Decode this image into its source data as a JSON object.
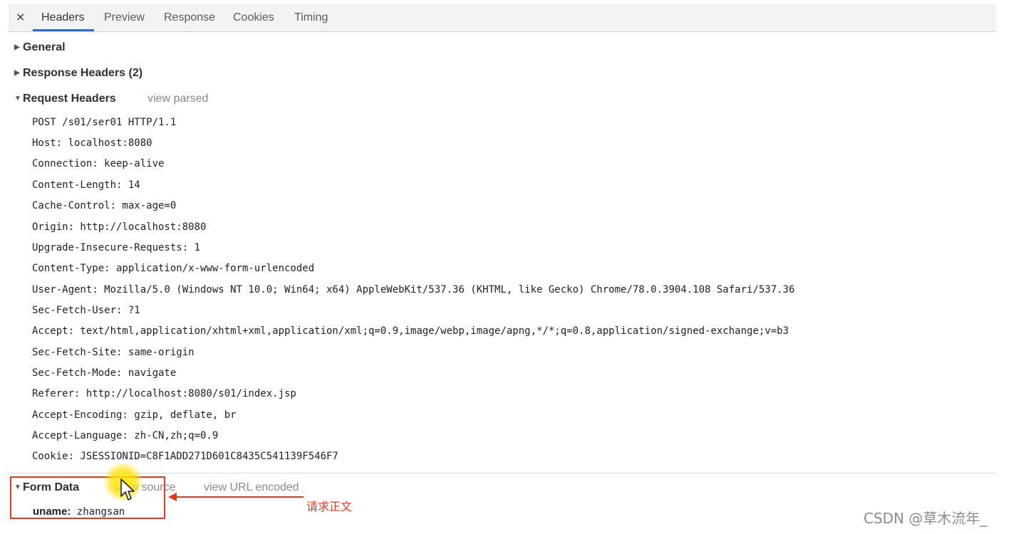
{
  "tabs": {
    "close": "×",
    "items": [
      "Headers",
      "Preview",
      "Response",
      "Cookies",
      "Timing"
    ],
    "active": "Headers"
  },
  "sections": {
    "general": "General",
    "response_headers": "Response Headers (2)",
    "request_headers": "Request Headers",
    "request_view_link": "view parsed",
    "form_data": "Form Data",
    "form_view_source": "view source",
    "form_view_url": "view URL encoded"
  },
  "request_lines": [
    "POST /s01/ser01 HTTP/1.1",
    "Host: localhost:8080",
    "Connection: keep-alive",
    "Content-Length: 14",
    "Cache-Control: max-age=0",
    "Origin: http://localhost:8080",
    "Upgrade-Insecure-Requests: 1",
    "Content-Type: application/x-www-form-urlencoded",
    "User-Agent: Mozilla/5.0 (Windows NT 10.0; Win64; x64) AppleWebKit/537.36 (KHTML, like Gecko) Chrome/78.0.3904.108 Safari/537.36",
    "Sec-Fetch-User: ?1",
    "Accept: text/html,application/xhtml+xml,application/xml;q=0.9,image/webp,image/apng,*/*;q=0.8,application/signed-exchange;v=b3",
    "Sec-Fetch-Site: same-origin",
    "Sec-Fetch-Mode: navigate",
    "Referer: http://localhost:8080/s01/index.jsp",
    "Accept-Encoding: gzip, deflate, br",
    "Accept-Language: zh-CN,zh;q=0.9",
    "Cookie: JSESSIONID=C8F1ADD271D601C8435C541139F546F7"
  ],
  "form_data": {
    "key": "uname:",
    "value": "zhangsan"
  },
  "annotation": {
    "text": "请求正文",
    "color": "#e23b22"
  },
  "watermark": "CSDN @草木流年_",
  "colors": {
    "accent": "#1a73e8",
    "tabbar_bg": "#f3f3f3"
  }
}
